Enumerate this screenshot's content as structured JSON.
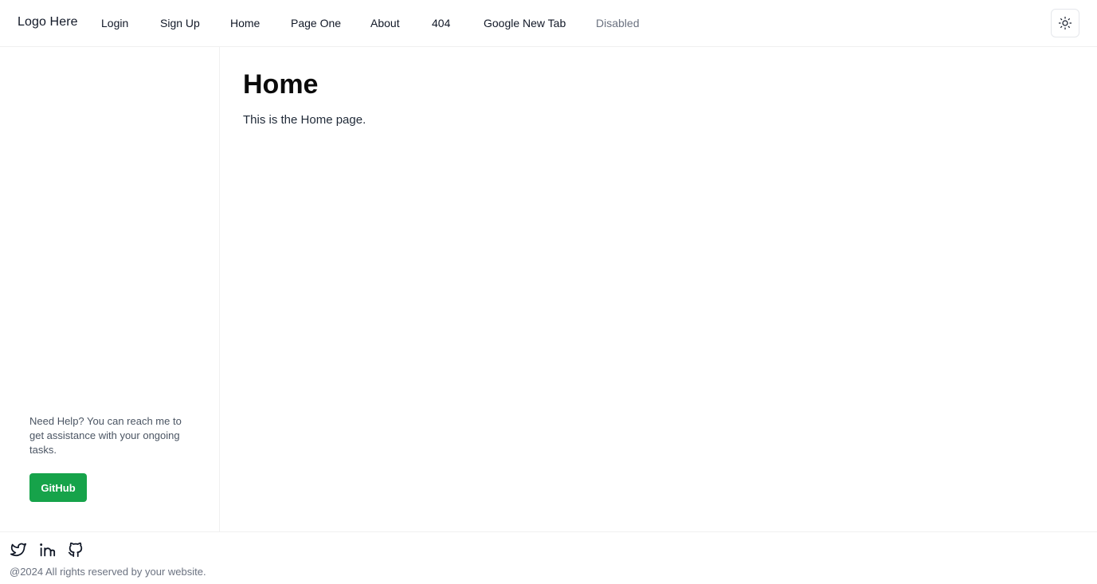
{
  "header": {
    "logo": "Logo Here",
    "nav": [
      {
        "label": "Login"
      },
      {
        "label": "Sign Up"
      },
      {
        "label": "Home"
      },
      {
        "label": "Page One"
      },
      {
        "label": "About"
      },
      {
        "label": "404"
      },
      {
        "label": "Google New Tab"
      },
      {
        "label": "Disabled",
        "disabled": true
      }
    ],
    "theme_toggle_icon": "sun-icon"
  },
  "sidebar": {
    "help_text": "Need Help? You can reach me to get assistance with your ongoing tasks.",
    "github_button": "GitHub"
  },
  "main": {
    "title": "Home",
    "description": "This is the Home page."
  },
  "footer": {
    "social_icons": [
      "twitter-icon",
      "linkedin-icon",
      "github-icon"
    ],
    "copyright": "@2024 All rights reserved by your website."
  },
  "colors": {
    "accent": "#16a34a",
    "border": "#f0f0f0",
    "muted_text": "#6b7280"
  }
}
